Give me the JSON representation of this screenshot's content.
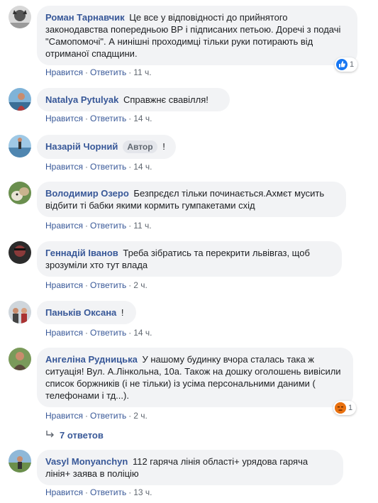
{
  "comments": [
    {
      "author": "Роман Тарнавчик",
      "text": "Це все у відповідності до прийнятого законодавства попередньою ВР і підписаних петьою. Доречі з подачі \"Самопомочі\". А нинішні проходимці тільки руки потирають від отриманої спадщини.",
      "like": "Нравится",
      "reply": "Ответить",
      "time": "11 ч.",
      "reaction_count": "1"
    },
    {
      "author": "Natalya Pytulyak",
      "text": "Справжнє свавілля!",
      "like": "Нравится",
      "reply": "Ответить",
      "time": "14 ч."
    },
    {
      "author": "Назарій Чорний",
      "badge": "Автор",
      "text": "!",
      "like": "Нравится",
      "reply": "Ответить",
      "time": "14 ч."
    },
    {
      "author": "Володимир Озеро",
      "text": "Безпрєдєл тільки починається.Ахмєт мусить відбити ті бабки якими кормить гумпакетами схід",
      "like": "Нравится",
      "reply": "Ответить",
      "time": "11 ч."
    },
    {
      "author": "Геннадій Іванов",
      "text": "Треба зібратись та перекрити львівгаз, щоб зрозуміли хто тут влада",
      "like": "Нравится",
      "reply": "Ответить",
      "time": "2 ч."
    },
    {
      "author": "Паньків Оксана",
      "text": "!",
      "like": "Нравится",
      "reply": "Ответить",
      "time": "14 ч."
    },
    {
      "author": "Ангеліна Рудницька",
      "text": "У нашому будинку вчора сталась така ж ситуація! Вул. А.Лінкольна, 10а. Також на дошку оголошень вивісили список боржників (і не тільки) із усіма персональними даними ( телефонами і тд...).",
      "like": "Нравится",
      "reply": "Ответить",
      "time": "2 ч.",
      "reaction_count": "1"
    },
    {
      "author": "Vasyl Monyanchyn",
      "text": "112 гаряча лінія області+ урядова гаряча лінія+ заява в поліцію",
      "like": "Нравится",
      "reply": "Ответить",
      "time": "13 ч."
    }
  ],
  "replies_label": "7 ответов",
  "colors": {
    "author": "#385898",
    "bubble": "#f2f3f5",
    "meta": "#606770",
    "like_reaction": "#1877f2",
    "angry_reaction": "#e9710f"
  }
}
